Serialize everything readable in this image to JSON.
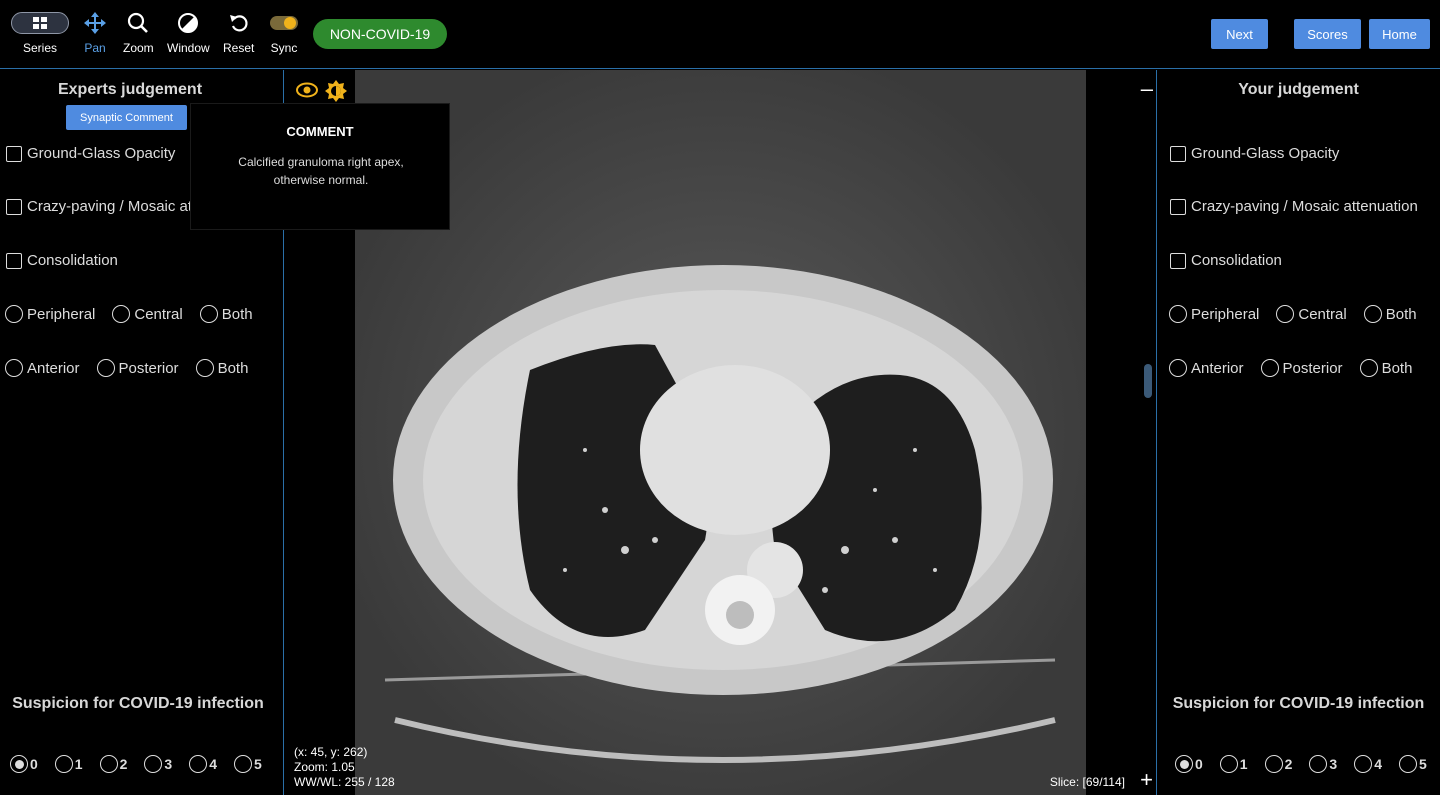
{
  "toolbar": {
    "tools": [
      {
        "label": "Series",
        "icon": "grid-icon"
      },
      {
        "label": "Pan",
        "icon": "move-icon",
        "active": true
      },
      {
        "label": "Zoom",
        "icon": "magnifier-icon"
      },
      {
        "label": "Window",
        "icon": "contrast-icon"
      },
      {
        "label": "Reset",
        "icon": "undo-icon"
      },
      {
        "label": "Sync",
        "icon": "toggle-icon"
      }
    ],
    "diagnosis_badge": "NON-COVID-19",
    "next_label": "Next",
    "scores_label": "Scores",
    "home_label": "Home"
  },
  "experts": {
    "title": "Experts judgement",
    "synaptic_button": "Synaptic Comment",
    "ggo": "Ground-Glass Opacity",
    "crazy": "Crazy-paving / Mosaic attenuation",
    "consolidation": "Consolidation",
    "peripheral": "Peripheral",
    "central": "Central",
    "both1": "Both",
    "anterior": "Anterior",
    "posterior": "Posterior",
    "both2": "Both",
    "suspicion_title": "Suspicion for COVID-19 infection",
    "scores": [
      "0",
      "1",
      "2",
      "3",
      "4",
      "5"
    ],
    "selected_score": "0"
  },
  "yours": {
    "title": "Your judgement",
    "ggo": "Ground-Glass Opacity",
    "crazy": "Crazy-paving / Mosaic attenuation",
    "consolidation": "Consolidation",
    "peripheral": "Peripheral",
    "central": "Central",
    "both1": "Both",
    "anterior": "Anterior",
    "posterior": "Posterior",
    "both2": "Both",
    "suspicion_title": "Suspicion for COVID-19 infection",
    "scores": [
      "0",
      "1",
      "2",
      "3",
      "4",
      "5"
    ],
    "selected_score": "0"
  },
  "comment": {
    "title": "COMMENT",
    "text": "Calcified granuloma right apex, otherwise normal."
  },
  "viewer": {
    "coords": "(x: 45, y: 262)",
    "zoom": "Zoom: 1.05",
    "wwwl": "WW/WL: 255 / 128",
    "slice": "Slice: [69/114]",
    "minus": "–",
    "plus": "+"
  },
  "colors": {
    "accent": "#4f8be0",
    "badge": "#2e8a2e",
    "divider": "#2a6fa8",
    "active_tool": "#5aa0e6"
  }
}
